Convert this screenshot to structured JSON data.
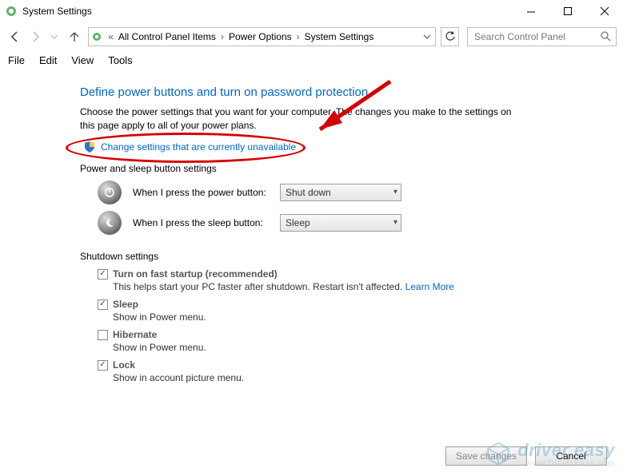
{
  "window": {
    "title": "System Settings"
  },
  "breadcrumb": {
    "items": [
      "All Control Panel Items",
      "Power Options",
      "System Settings"
    ]
  },
  "search": {
    "placeholder": "Search Control Panel"
  },
  "menu": {
    "file": "File",
    "edit": "Edit",
    "view": "View",
    "tools": "Tools"
  },
  "page": {
    "title": "Define power buttons and turn on password protection",
    "desc": "Choose the power settings that you want for your computer. The changes you make to the settings on this page apply to all of your power plans.",
    "change_link": "Change settings that are currently unavailable",
    "power_sleep_heading": "Power and sleep button settings",
    "power_label": "When I press the power button:",
    "power_value": "Shut down",
    "sleep_label": "When I press the sleep button:",
    "sleep_value": "Sleep",
    "shutdown_heading": "Shutdown settings",
    "fast_startup": {
      "title": "Turn on fast startup (recommended)",
      "desc": "This helps start your PC faster after shutdown. Restart isn't affected. ",
      "learn_more": "Learn More"
    },
    "sleep_opt": {
      "title": "Sleep",
      "desc": "Show in Power menu."
    },
    "hibernate_opt": {
      "title": "Hibernate",
      "desc": "Show in Power menu."
    },
    "lock_opt": {
      "title": "Lock",
      "desc": "Show in account picture menu."
    }
  },
  "footer": {
    "save": "Save changes",
    "cancel": "Cancel"
  },
  "watermark": {
    "brand": "driver easy",
    "url": "www.DriverEasy.com"
  }
}
